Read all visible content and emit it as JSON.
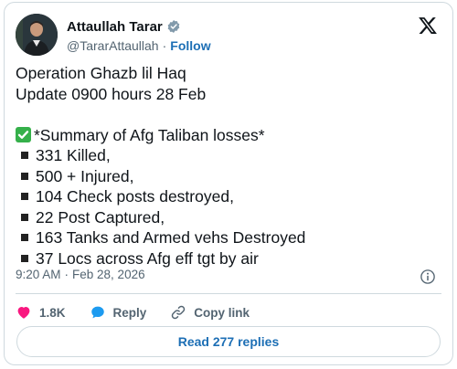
{
  "author": {
    "name": "Attaullah Tarar",
    "handle": "@TararAttaullah",
    "separator": "·",
    "follow_label": "Follow",
    "verified_icon": "verified-badge-icon",
    "avatar_alt": "profile picture"
  },
  "post": {
    "lines": [
      "Operation Ghazb lil Haq",
      "Update 0900 hours 28 Feb"
    ],
    "summary": "*Summary of Afg Taliban losses*",
    "items": [
      "331 Killed,",
      "500 + Injured,",
      "104 Check posts destroyed,",
      "22 Post Captured,",
      "163 Tanks and Armed vehs Destroyed",
      "37 Locs across Afg eff tgt by air"
    ]
  },
  "meta": {
    "time": "9:20 AM",
    "separator": "·",
    "date": "Feb 28, 2026"
  },
  "actions": {
    "like_count": "1.8K",
    "reply_label": "Reply",
    "copy_link_label": "Copy link"
  },
  "replies_button": "Read 277 replies",
  "colors": {
    "accent": "#1d6fb5",
    "like": "#f91880",
    "reply": "#1d9bf0",
    "check": "#35b04a",
    "muted": "#536471"
  }
}
